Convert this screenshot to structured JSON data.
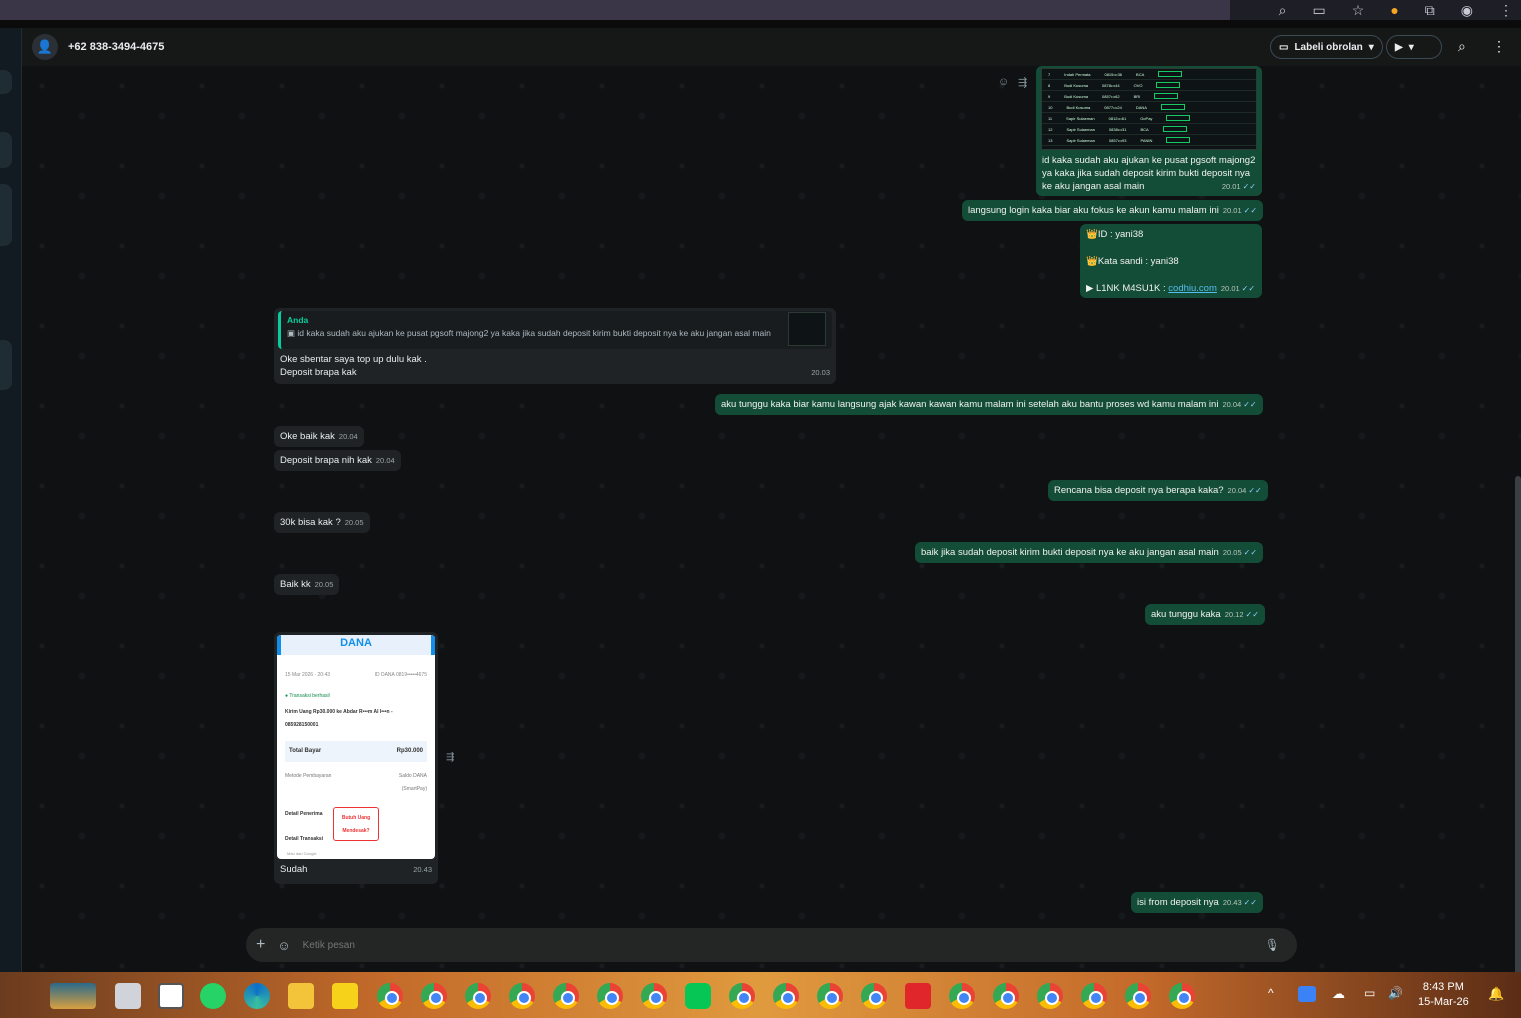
{
  "chat": {
    "contact": "+62 838-3494-4675",
    "label_button": "Labeli obrolan"
  },
  "messages": {
    "m1": {
      "text": "id kaka sudah aku ajukan ke pusat pgsoft majong2 ya kaka jika sudah deposit kirim bukti deposit nya ke aku jangan asal main",
      "time": "20.01"
    },
    "m2": {
      "text": "langsung login kaka biar aku fokus ke akun kamu malam ini",
      "time": "20.01"
    },
    "m3": {
      "id_line": "ID :  yani38",
      "pass_line": "Kata sandi : yani38",
      "link_label": "L1NK M4SU1K : ",
      "link": "codhiu.com",
      "time": "20.01"
    },
    "m4": {
      "quote_author": "Anda",
      "quote_text": "id kaka sudah aku ajukan ke pusat pgsoft majong2 ya kaka jika sudah deposit kirim bukti deposit nya ke aku jangan asal main",
      "line1": "Oke sbentar saya top up dulu kak .",
      "line2": "Deposit brapa kak",
      "time": "20.03"
    },
    "m5": {
      "text": "aku tunggu kaka biar kamu langsung ajak kawan kawan kamu malam ini setelah aku bantu proses wd kamu malam ini",
      "time": "20.04"
    },
    "m6": {
      "text": "Oke baik kak",
      "time": "20.04"
    },
    "m7": {
      "text": "Deposit brapa nih kak",
      "time": "20.04"
    },
    "m8": {
      "text": "Rencana bisa deposit nya berapa kaka?",
      "time": "20.04"
    },
    "m9": {
      "text": "30k bisa kak ?",
      "time": "20.05"
    },
    "m10": {
      "text": "baik jika sudah deposit kirim bukti deposit nya ke aku jangan asal main",
      "time": "20.05"
    },
    "m11": {
      "text": "Baik kk",
      "time": "20.05"
    },
    "m12": {
      "text": "aku tunggu kaka",
      "time": "20.12"
    },
    "m13": {
      "caption": "Sudah",
      "time": "20.43"
    },
    "m14": {
      "text": "isi from deposit nya",
      "time": "20.43"
    }
  },
  "receipt": {
    "brand": "DANA",
    "date": "15 Mar 2026 · 20:43",
    "id": "ID DANA 0819•••••4675",
    "status": "Transaksi berhasil",
    "desc": "Kirim Uang Rp30.000 ke Abdar R•••m Al l•••n - 085928150001",
    "total_label": "Total Bayar",
    "total_value": "Rp30.000",
    "method_label": "Metode Pembayaran",
    "method_value": "Saldo DANA (SmartPay)",
    "detail1": "Detail Penerima",
    "detail2": "Detail Transaksi",
    "ad": "Butuh Uang Mendesak?",
    "footer": "Mau dari Google"
  },
  "composer": {
    "placeholder": "Ketik pesan"
  },
  "taskbar": {
    "time": "8:43 PM",
    "date": "15-Mar-26"
  },
  "colors": {
    "outgoing": "#144d37",
    "incoming": "#1f2325",
    "accent": "#25d366"
  }
}
